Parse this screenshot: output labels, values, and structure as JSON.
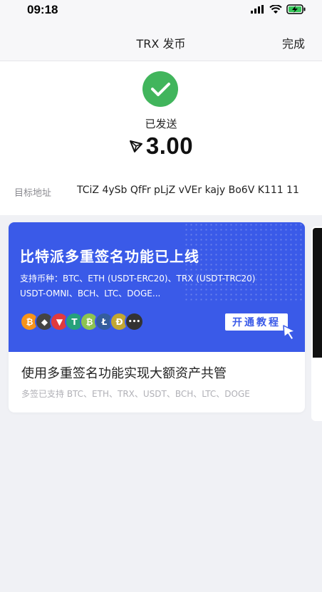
{
  "status_bar": {
    "time": "09:18"
  },
  "nav": {
    "title": "TRX 发币",
    "done_label": "完成"
  },
  "result": {
    "status_text": "已发送",
    "amount": "3.00",
    "address_label": "目标地址",
    "address_value": "TCiZ 4ySb QfFr pLjZ vVEr kajy Bo6V K111 11"
  },
  "banner": {
    "title": "比特派多重签名功能已上线",
    "subtitle_line1": "支持币种：BTC、ETH (USDT-ERC20)、TRX (USDT-TRC20)",
    "subtitle_line2": "USDT-OMNI、BCH、LTC、DOGE...",
    "button_label": "开通教程",
    "coins": [
      {
        "glyph": "₿",
        "color": "#f7931a"
      },
      {
        "glyph": "◆",
        "color": "#444444"
      },
      {
        "glyph": "▼",
        "color": "#e03a3e"
      },
      {
        "glyph": "T",
        "color": "#26a17b"
      },
      {
        "glyph": "₿",
        "color": "#8dc351"
      },
      {
        "glyph": "Ł",
        "color": "#345d9d"
      },
      {
        "glyph": "Ð",
        "color": "#c2a633"
      },
      {
        "glyph": "•••",
        "color": "#333333"
      }
    ]
  },
  "card": {
    "title": "使用多重签名功能实现大额资产共管",
    "subtitle": "多签已支持 BTC、ETH、TRX、USDT、BCH、LTC、DOGE"
  },
  "colors": {
    "accent": "#3a5ae8",
    "success": "#41b55c"
  }
}
